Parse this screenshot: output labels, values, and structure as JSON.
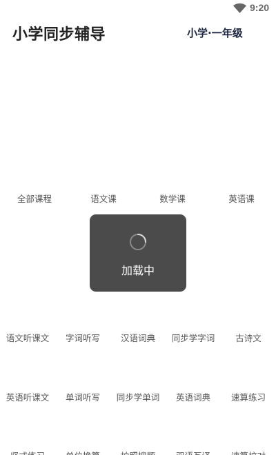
{
  "status_bar": {
    "time": "9:20",
    "wifi_icon": "wifi-icon"
  },
  "header": {
    "title": "小学同步辅导",
    "grade": "小学·一年级"
  },
  "tabs": [
    {
      "label": "全部课程"
    },
    {
      "label": "语文课"
    },
    {
      "label": "数学课"
    },
    {
      "label": "英语课"
    }
  ],
  "tools": {
    "row1": [
      "语文听课文",
      "字词听写",
      "汉语词典",
      "同步学字词",
      "古诗文"
    ],
    "row2": [
      "英语听课文",
      "单词听写",
      "同步学单词",
      "英语词典",
      "速算练习"
    ],
    "row3": [
      "竖式练习",
      "单位换算",
      "拍照搜题",
      "双语互译",
      "速算校对"
    ]
  },
  "loading": {
    "text": "加载中",
    "spinner_icon": "spinner-icon"
  }
}
